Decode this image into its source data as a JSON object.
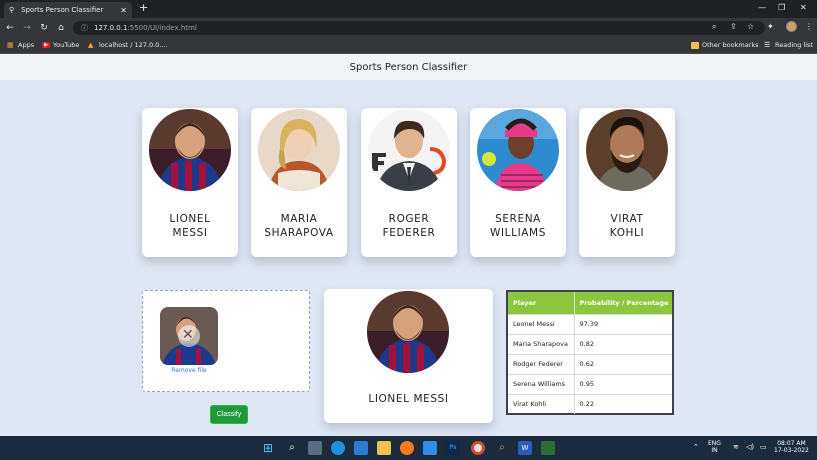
{
  "browser": {
    "tab_title": "Sports Person Classifier",
    "url_host": "127.0.0.1",
    "url_path": ":5500/UI/index.html",
    "bookmarks": [
      "Apps",
      "YouTube",
      "localhost / 127.0.0...."
    ],
    "other_bookmarks": "Other bookmarks",
    "reading_list": "Reading list"
  },
  "page": {
    "title": "Sports Person Classifier"
  },
  "players": [
    {
      "line1": "LIONEL",
      "line2": "MESSI"
    },
    {
      "line1": "MARIA",
      "line2": "SHARAPOVA"
    },
    {
      "line1": "ROGER",
      "line2": "FEDERER"
    },
    {
      "line1": "SERENA",
      "line2": "WILLIAMS"
    },
    {
      "line1": "VIRAT",
      "line2": "KOHLI"
    }
  ],
  "upload": {
    "remove_label": "Remove file",
    "classify_label": "Classify"
  },
  "result": {
    "name": "LIONEL MESSI"
  },
  "prob_table": {
    "headers": [
      "Player",
      "Probability / Percentage"
    ],
    "rows": [
      [
        "Leonel Messi",
        "97.39"
      ],
      [
        "Maria Sharapova",
        "0.82"
      ],
      [
        "Rodger Federer",
        "0.62"
      ],
      [
        "Serena Williams",
        "0.95"
      ],
      [
        "Virat Kohli",
        "0.22"
      ]
    ]
  },
  "taskbar": {
    "lang_line1": "ENG",
    "lang_line2": "IN",
    "time": "08:07 AM",
    "date": "17-03-2022"
  }
}
